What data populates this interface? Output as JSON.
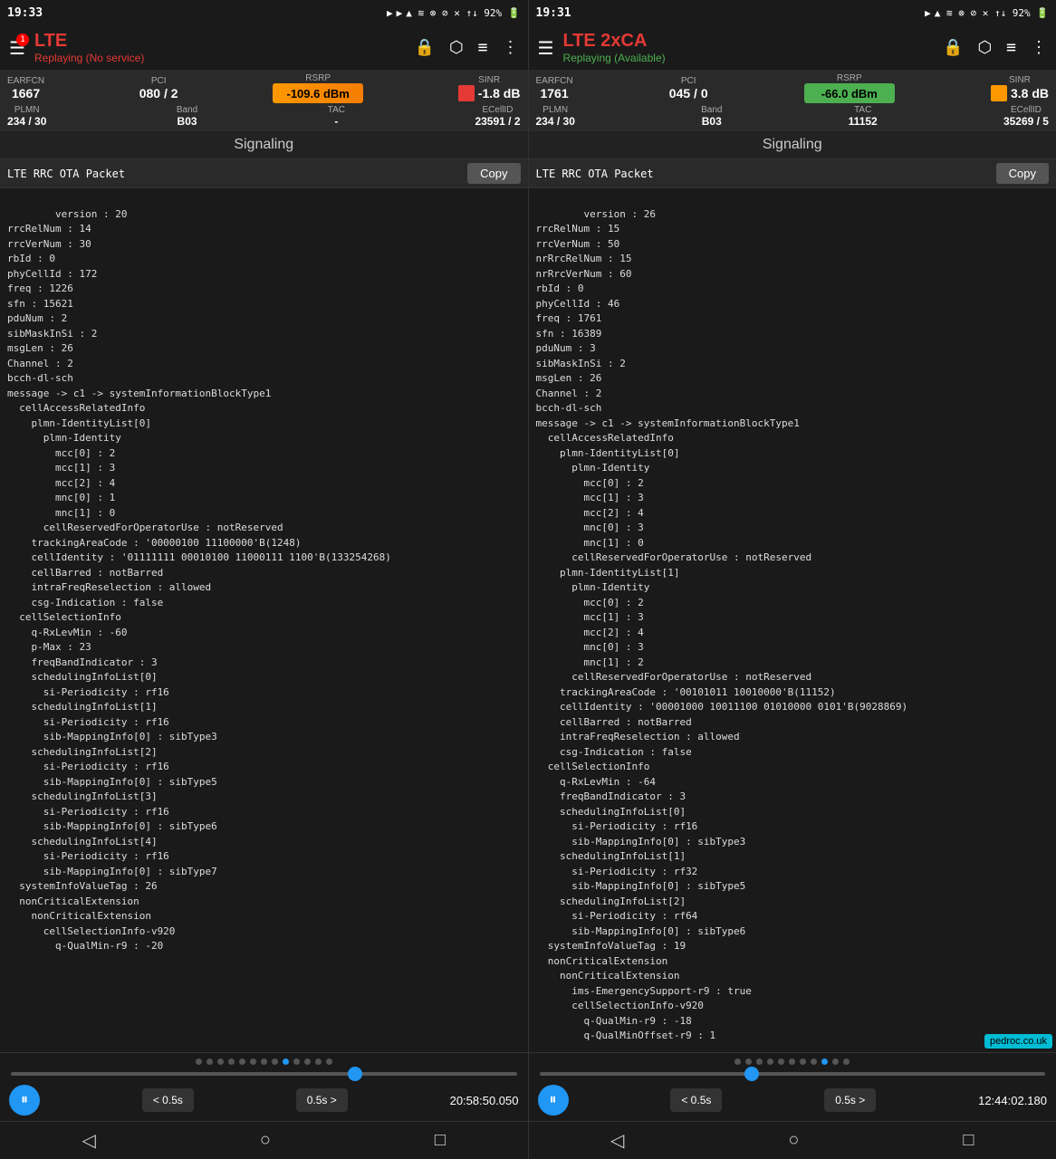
{
  "left_panel": {
    "status_time": "19:33",
    "app_title": "LTE",
    "app_subtitle": "Replaying (No service)",
    "badge": "1",
    "metrics": {
      "earfcn_label": "EARFCN",
      "earfcn_value": "1667",
      "pci_label": "PCI",
      "pci_value": "080 / 2",
      "rsrp_label": "RSRP",
      "rsrp_value": "-109.6 dBm",
      "rsrp_color": "orange",
      "sinr_label": "SINR",
      "sinr_value": "-1.8 dB",
      "sinr_color": "red",
      "plmn_label": "PLMN",
      "plmn_value": "234 / 30",
      "band_label": "Band",
      "band_value": "B03",
      "tac_label": "TAC",
      "tac_value": "-",
      "ecellid_label": "ECellID",
      "ecellid_value": "23591 / 2"
    },
    "signaling_title": "Signaling",
    "packet_title": "LTE RRC OTA Packet",
    "copy_label": "Copy",
    "packet_body": "version : 20\nrrcRelNum : 14\nrrcVerNum : 30\nrbId : 0\nphyCellId : 172\nfreq : 1226\nsfn : 15621\npduNum : 2\nsibMaskInSi : 2\nmsgLen : 26\nChannel : 2\nbcch-dl-sch\nmessage -> c1 -> systemInformationBlockType1\n  cellAccessRelatedInfo\n    plmn-IdentityList[0]\n      plmn-Identity\n        mcc[0] : 2\n        mcc[1] : 3\n        mcc[2] : 4\n        mnc[0] : 1\n        mnc[1] : 0\n      cellReservedForOperatorUse : notReserved\n    trackingAreaCode : '00000100 11100000'B(1248)\n    cellIdentity : '01111111 00010100 11000111 1100'B(133254268)\n    cellBarred : notBarred\n    intraFreqReselection : allowed\n    csg-Indication : false\n  cellSelectionInfo\n    q-RxLevMin : -60\n    p-Max : 23\n    freqBandIndicator : 3\n    schedulingInfoList[0]\n      si-Periodicity : rf16\n    schedulingInfoList[1]\n      si-Periodicity : rf16\n      sib-MappingInfo[0] : sibType3\n    schedulingInfoList[2]\n      si-Periodicity : rf16\n      sib-MappingInfo[0] : sibType5\n    schedulingInfoList[3]\n      si-Periodicity : rf16\n      sib-MappingInfo[0] : sibType6\n    schedulingInfoList[4]\n      si-Periodicity : rf16\n      sib-MappingInfo[0] : sibType7\n  systemInfoValueTag : 26\n  nonCriticalExtension\n    nonCriticalExtension\n      cellSelectionInfo-v920\n        q-QualMin-r9 : -20",
    "slider_position_pct": 68,
    "time_display": "20:58:50.050",
    "controls": {
      "play_icon": "⏸",
      "back_label": "< 0.5s",
      "fwd_label": "0.5s >"
    }
  },
  "right_panel": {
    "status_time": "19:31",
    "app_title": "LTE 2xCA",
    "app_subtitle": "Replaying (Available)",
    "metrics": {
      "earfcn_label": "EARFCN",
      "earfcn_value": "1761",
      "pci_label": "PCI",
      "pci_value": "045 / 0",
      "rsrp_label": "RSRP",
      "rsrp_value": "-66.0 dBm",
      "rsrp_color": "green",
      "sinr_label": "SINR",
      "sinr_value": "3.8 dB",
      "sinr_color": "orange",
      "plmn_label": "PLMN",
      "plmn_value": "234 / 30",
      "band_label": "Band",
      "band_value": "B03",
      "tac_label": "TAC",
      "tac_value": "11152",
      "ecellid_label": "ECellID",
      "ecellid_value": "35269 / 5"
    },
    "signaling_title": "Signaling",
    "packet_title": "LTE RRC OTA Packet",
    "copy_label": "Copy",
    "packet_body": "version : 26\nrrcRelNum : 15\nrrcVerNum : 50\nnrRrcRelNum : 15\nnrRrcVerNum : 60\nrbId : 0\nphyCellId : 46\nfreq : 1761\nsfn : 16389\npduNum : 3\nsibMaskInSi : 2\nmsgLen : 26\nChannel : 2\nbcch-dl-sch\nmessage -> c1 -> systemInformationBlockType1\n  cellAccessRelatedInfo\n    plmn-IdentityList[0]\n      plmn-Identity\n        mcc[0] : 2\n        mcc[1] : 3\n        mcc[2] : 4\n        mnc[0] : 3\n        mnc[1] : 0\n      cellReservedForOperatorUse : notReserved\n    plmn-IdentityList[1]\n      plmn-Identity\n        mcc[0] : 2\n        mcc[1] : 3\n        mcc[2] : 4\n        mnc[0] : 3\n        mnc[1] : 2\n      cellReservedForOperatorUse : notReserved\n    trackingAreaCode : '00101011 10010000'B(11152)\n    cellIdentity : '00001000 10011100 01010000 0101'B(9028869)\n    cellBarred : notBarred\n    intraFreqReselection : allowed\n    csg-Indication : false\n  cellSelectionInfo\n    q-RxLevMin : -64\n    freqBandIndicator : 3\n    schedulingInfoList[0]\n      si-Periodicity : rf16\n      sib-MappingInfo[0] : sibType3\n    schedulingInfoList[1]\n      si-Periodicity : rf32\n      sib-MappingInfo[0] : sibType5\n    schedulingInfoList[2]\n      si-Periodicity : rf64\n      sib-MappingInfo[0] : sibType6\n  systemInfoValueTag : 19\n  nonCriticalExtension\n    nonCriticalExtension\n      ims-EmergencySupport-r9 : true\n      cellSelectionInfo-v920\n        q-QualMin-r9 : -18\n        q-QualMinOffset-r9 : 1",
    "slider_position_pct": 42,
    "time_display": "12:44:02.180",
    "controls": {
      "play_icon": "⏸",
      "back_label": "< 0.5s",
      "fwd_label": "0.5s >"
    }
  },
  "watermark": "pedroc.co.uk",
  "nav": {
    "back": "◁",
    "home": "○",
    "recent": "□"
  },
  "dots_left": [
    0,
    0,
    0,
    0,
    0,
    0,
    0,
    0,
    1,
    0,
    0,
    0,
    0
  ],
  "dots_right": [
    0,
    0,
    0,
    0,
    0,
    0,
    0,
    0,
    1,
    0,
    0
  ]
}
